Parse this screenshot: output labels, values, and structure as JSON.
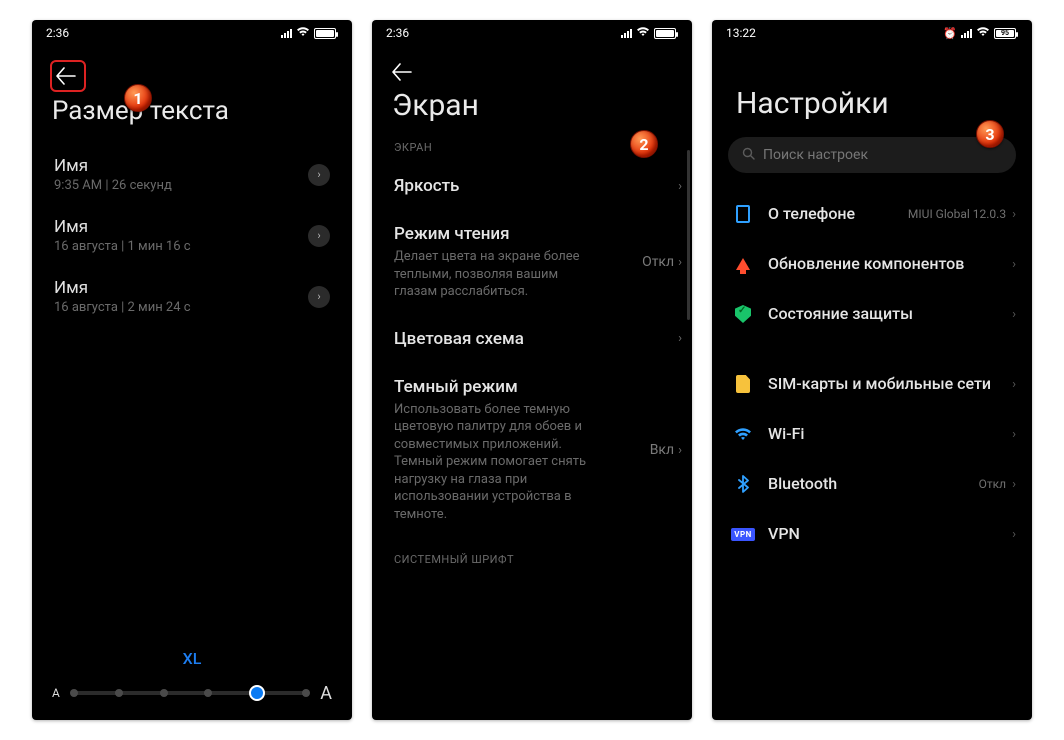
{
  "screen1": {
    "time": "2:36",
    "title": "Размер текста",
    "items": [
      {
        "name": "Имя",
        "sub": "9:35 AM | 26 секунд"
      },
      {
        "name": "Имя",
        "sub": "16 августа | 1 мин 16 с"
      },
      {
        "name": "Имя",
        "sub": "16 августа | 2 мин 24 с"
      }
    ],
    "size_label": "XL",
    "badge": "1"
  },
  "screen2": {
    "time": "2:36",
    "title": "Экран",
    "section": "ЭКРАН",
    "items": [
      {
        "title": "Яркость",
        "desc": "",
        "value": ""
      },
      {
        "title": "Режим чтения",
        "desc": "Делает цвета на экране более теплыми, позволяя вашим глазам расслабиться.",
        "value": "Откл"
      },
      {
        "title": "Цветовая схема",
        "desc": "",
        "value": ""
      },
      {
        "title": "Темный режим",
        "desc": "Использовать более темную цветовую палитру для обоев и совместимых приложений. Темный режим помогает снять нагрузку на глаза при использовании устройства в темноте.",
        "value": "Вкл"
      }
    ],
    "footer_section": "СИСТЕМНЫЙ ШРИФТ",
    "badge": "2"
  },
  "screen3": {
    "time": "13:22",
    "battery_pct": "95",
    "title": "Настройки",
    "search_placeholder": "Поиск настроек",
    "items": [
      {
        "icon": "phone",
        "label": "О телефоне",
        "value": "MIUI Global 12.0.3"
      },
      {
        "icon": "update",
        "label": "Обновление компонентов",
        "value": ""
      },
      {
        "icon": "shield",
        "label": "Состояние защиты",
        "value": ""
      },
      {
        "icon": "sim",
        "label": "SIM-карты и мобильные сети",
        "value": ""
      },
      {
        "icon": "wifi",
        "label": "Wi-Fi",
        "value": ""
      },
      {
        "icon": "bluetooth",
        "label": "Bluetooth",
        "value": "Откл"
      },
      {
        "icon": "vpn",
        "label": "VPN",
        "value": ""
      }
    ],
    "badge": "3"
  }
}
